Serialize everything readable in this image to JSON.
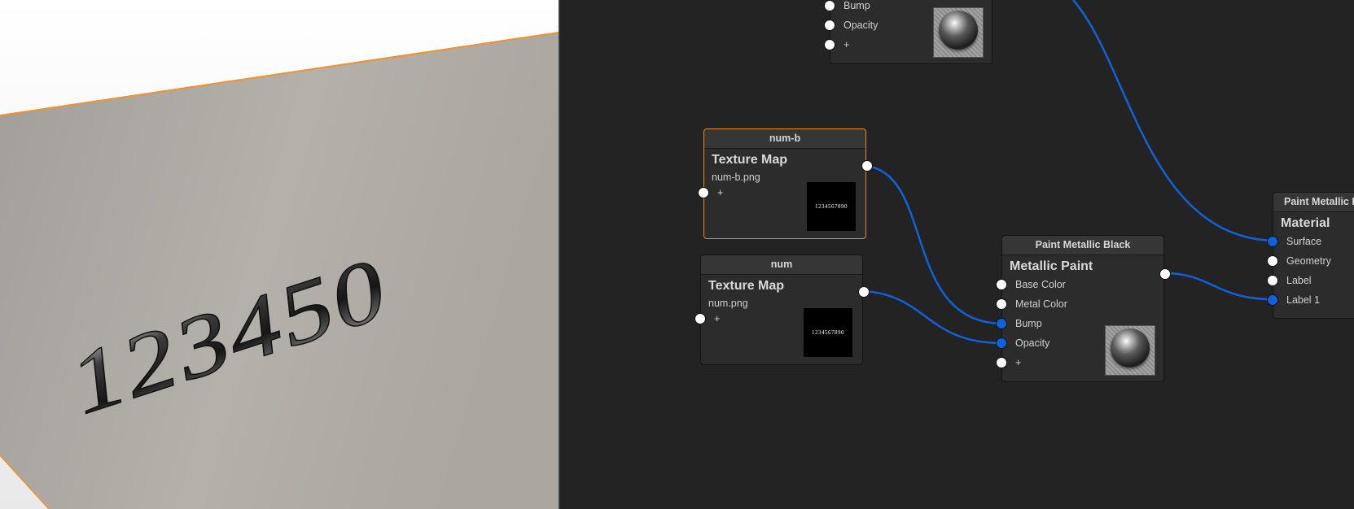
{
  "viewport": {
    "digits_text": "123450",
    "edge_color": "#f0922e",
    "panel_color": "#b1aca6"
  },
  "nodes": {
    "top": {
      "ports": [
        "Bump",
        "Opacity",
        "+"
      ]
    },
    "num_b": {
      "title": "num-b",
      "type": "Texture Map",
      "file": "num-b.png",
      "add": "+",
      "thumb_text": "1234567890"
    },
    "num": {
      "title": "num",
      "type": "Texture Map",
      "file": "num.png",
      "add": "+",
      "thumb_text": "1234567890"
    },
    "paint": {
      "title": "Paint Metallic Black",
      "type": "Metallic Paint",
      "ports": [
        "Base Color",
        "Metal Color",
        "Bump",
        "Opacity",
        "+"
      ]
    },
    "material": {
      "title": "Paint Metallic Black",
      "type": "Material",
      "ports": [
        "Surface",
        "Geometry",
        "Label",
        "Label 1"
      ]
    }
  },
  "colors": {
    "wire": "#0f62d9",
    "selected_border": "#e98a2c",
    "background": "#232323"
  }
}
